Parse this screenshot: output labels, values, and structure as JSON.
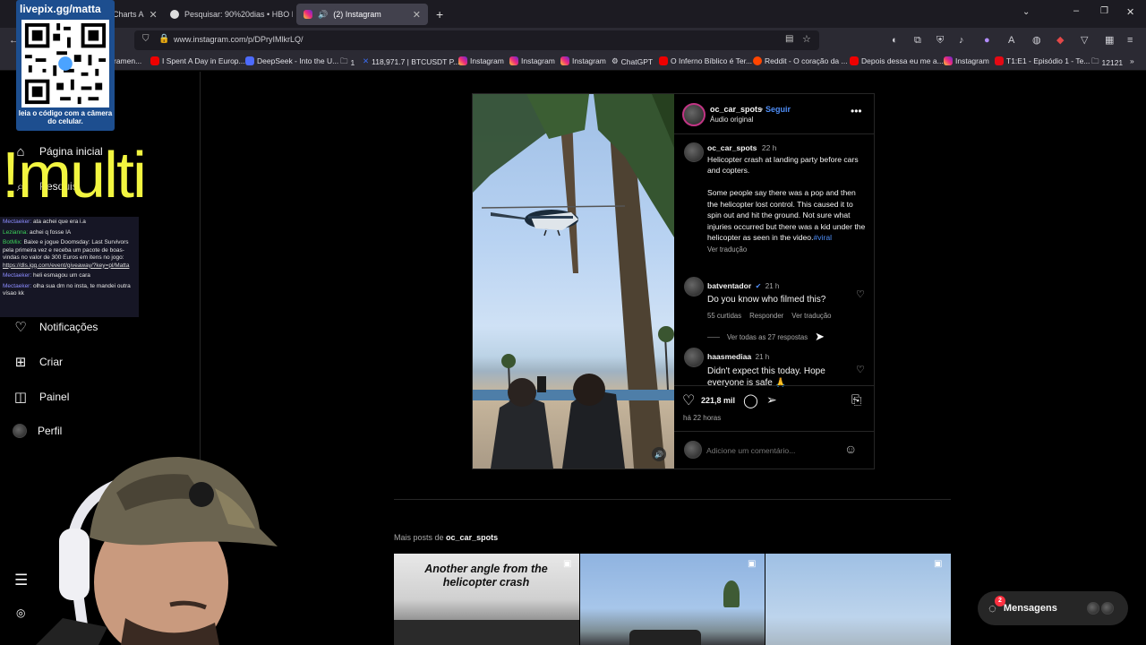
{
  "browser": {
    "tabs": [
      {
        "label": "Charts A",
        "active": false
      },
      {
        "label": "Pesquisar: 90%20dias • HBO M",
        "active": false
      },
      {
        "label": "(2) Instagram",
        "active": true
      }
    ],
    "url": "www.instagram.com/p/DPryIMlkrLQ/",
    "bookmarks": [
      "ramen...",
      "I Spent A Day in Europ...",
      "DeepSeek - Into the U...",
      "1",
      "118,971.7 | BTCUSDT P...",
      "Instagram",
      "Instagram",
      "Instagram",
      "ChatGPT",
      "O Inferno Bíblico é Ter...",
      "Reddit - O coração da ...",
      "Depois dessa eu me a...",
      "Instagram",
      "T1:E1 - Episódio 1 - Te...",
      "12121"
    ]
  },
  "sidebar": {
    "items": [
      {
        "label": "Página inicial",
        "icon": "home-icon"
      },
      {
        "label": "Pesquis",
        "icon": "search-icon"
      },
      {
        "label": "Notificações",
        "icon": "heart-icon"
      },
      {
        "label": "Criar",
        "icon": "plus-square-icon"
      },
      {
        "label": "Painel",
        "icon": "chart-icon"
      },
      {
        "label": "Perfil",
        "icon": "avatar"
      }
    ]
  },
  "overlay": {
    "qr_title": "livepix.gg/matta",
    "qr_caption": "leia o código com a câmera do celular.",
    "multi": "!multi",
    "chat": [
      {
        "user": "Mectaeker:",
        "text": "ata achei que era i.a"
      },
      {
        "user": "Lezianna:",
        "text": "achei q fosse IA"
      },
      {
        "user": "BotMix:",
        "text": "Baixe e jogue Doomsday: Last Survivors pela primeira vez e receba um pacote de boas-vindas no valor de 300 Euros em itens no jogo:",
        "link": "https://dls.igg.com/event/giveaway/?key=pl/Matta"
      },
      {
        "user": "Mectaeker:",
        "text": "heli esmagou um cara"
      },
      {
        "user": "Mectaeker:",
        "text": "olha sua dm no insta, te mandei outra vísao kk"
      }
    ]
  },
  "post": {
    "author": "oc_car_spots",
    "follow": "Seguir",
    "audio": "Áudio original",
    "caption_time": "22 h",
    "caption_p1": "Helicopter crash at landing party before cars and copters.",
    "caption_p2": "Some people say there was a pop and then the helicopter lost control. This caused it to spin out and hit the ground. Not sure what injuries occurred but there was a kid under the helicopter as seen in the video.",
    "caption_tag": "#viral",
    "see_translation": "Ver tradução",
    "comments": [
      {
        "user": "batventador",
        "verified": true,
        "time": "21 h",
        "text": "Do you know who filmed this?",
        "likes": "55 curtidas",
        "reply": "Responder",
        "translate": "Ver tradução",
        "view_replies": "Ver todas as 27 respostas"
      },
      {
        "user": "haasmediaa",
        "time": "21 h",
        "text": "Didn't expect this today. Hope everyone is safe 🙏"
      }
    ],
    "likes": "221,8 mil",
    "posted": "há 22 horas",
    "comment_placeholder": "Adicione um comentário..."
  },
  "more": {
    "label_prefix": "Mais posts de",
    "label_user": "oc_car_spots",
    "thumb1_text": "Another angle from the helicopter crash"
  },
  "messages": {
    "label": "Mensagens",
    "badge": "2"
  }
}
